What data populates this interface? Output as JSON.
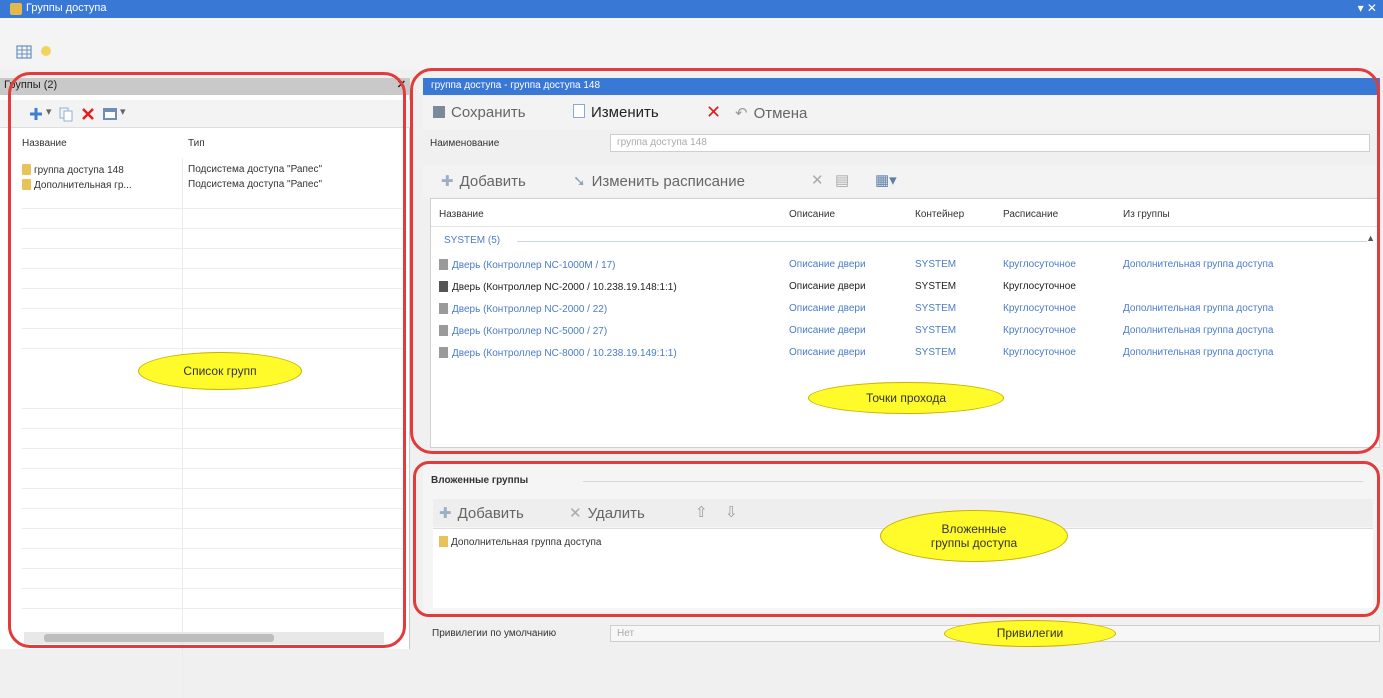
{
  "window": {
    "title": "Группы доступа",
    "controls": "▾ ✕"
  },
  "left": {
    "header": "Группы (2)",
    "columns": {
      "name": "Название",
      "type": "Тип"
    },
    "rows": [
      {
        "name": "группа доступа 148",
        "type": "Подсистема доступа \"Рапес\""
      },
      {
        "name": "Дополнительная гр...",
        "type": "Подсистема доступа \"Рапес\""
      }
    ]
  },
  "right": {
    "title": "группа доступа - группа доступа 148",
    "toolbar": {
      "save": "Сохранить",
      "edit": "Изменить",
      "cancel": "Отмена"
    },
    "name_label": "Наименование",
    "name_value": "группа доступа 148",
    "points_toolbar": {
      "add": "Добавить",
      "change_schedule": "Изменить расписание"
    },
    "columns": {
      "name": "Название",
      "description": "Описание",
      "container": "Контейнер",
      "schedule": "Расписание",
      "from_group": "Из группы"
    },
    "group_label": "SYSTEM (5)",
    "rows": [
      {
        "name": "Дверь (Контроллер NC-1000M / 17)",
        "desc": "Описание двери",
        "container": "SYSTEM",
        "schedule": "Круглосуточное",
        "group": "Дополнительная группа доступа"
      },
      {
        "name": "Дверь (Контроллер NC-2000 / 10.238.19.148:1:1)",
        "desc": "Описание двери",
        "container": "SYSTEM",
        "schedule": "Круглосуточное",
        "group": ""
      },
      {
        "name": "Дверь (Контроллер NC-2000 / 22)",
        "desc": "Описание двери",
        "container": "SYSTEM",
        "schedule": "Круглосуточное",
        "group": "Дополнительная группа доступа"
      },
      {
        "name": "Дверь (Контроллер NC-5000 / 27)",
        "desc": "Описание двери",
        "container": "SYSTEM",
        "schedule": "Круглосуточное",
        "group": "Дополнительная группа доступа"
      },
      {
        "name": "Дверь (Контроллер NC-8000 / 10.238.19.149:1:1)",
        "desc": "Описание двери",
        "container": "SYSTEM",
        "schedule": "Круглосуточное",
        "group": "Дополнительная группа доступа"
      }
    ]
  },
  "nested": {
    "caption": "Вложенные группы",
    "toolbar": {
      "add": "Добавить",
      "delete": "Удалить"
    },
    "items": [
      "Дополнительная группа доступа"
    ]
  },
  "privileges": {
    "label": "Привилегии по умолчанию",
    "value": "Нет"
  },
  "annotations": {
    "group_list": "Список групп",
    "access_points": "Точки прохода",
    "nested_groups_l1": "Вложенные",
    "nested_groups_l2": "группы доступа",
    "privileges": "Привилегии"
  },
  "colors": {
    "accent": "#3a78d6",
    "link": "#4a7cc7",
    "annotation_ring": "#e23b3b",
    "annotation_fill": "#fffb2a"
  }
}
